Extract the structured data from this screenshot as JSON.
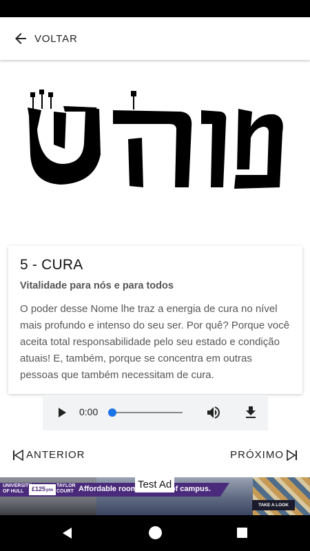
{
  "app_bar": {
    "back_label": "VOLTAR"
  },
  "hebrew_name": {
    "letters": "מוהש"
  },
  "card": {
    "title": "5 - CURA",
    "subtitle": "Vitalidade para nós e para todos",
    "body": "O poder desse Nome lhe traz a energia de cura no nível mais profundo e intenso do seu ser. Por quê? Porque você aceita total responsabilidade pelo seu estado e condição atuais! E, também, porque se concentra em outras pessoas que também necessitam de cura."
  },
  "audio": {
    "current_time": "0:00",
    "progress": 0
  },
  "navigation": {
    "previous_label": "ANTERIOR",
    "next_label": "PRÓXIMO"
  },
  "ad": {
    "test_label": "Test Ad",
    "university": "UNIVERSITY OF HULL",
    "price": "£125",
    "price_unit": "p/w",
    "court": "TAYLOR COURT",
    "headline": "Affordable rooms... heart of campus.",
    "cta": "TAKE A LOOK"
  },
  "colors": {
    "accent": "#1a73e8",
    "ad_purple": "#4a2a7a",
    "text_primary": "#212121",
    "text_secondary": "#555555"
  },
  "icons": {
    "back": "arrow-left-icon",
    "play": "play-icon",
    "volume": "volume-icon",
    "download": "download-icon",
    "previous": "skip-previous-icon",
    "next": "skip-next-icon"
  }
}
